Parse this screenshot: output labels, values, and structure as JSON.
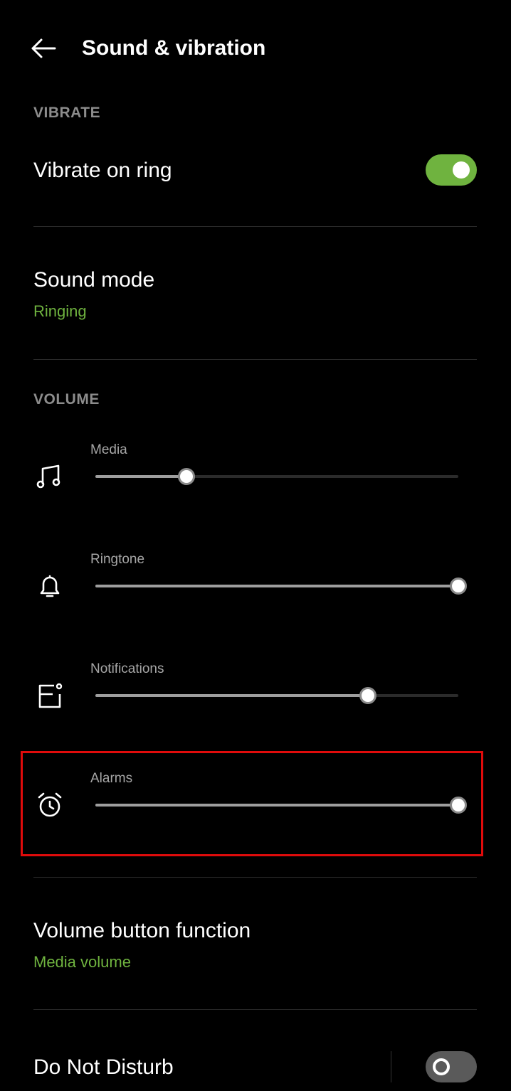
{
  "header": {
    "title": "Sound & vibration",
    "back_icon": "arrow-left-icon"
  },
  "vibrate_section": {
    "header": "VIBRATE",
    "vibrate_on_ring": {
      "label": "Vibrate on ring",
      "enabled": true
    }
  },
  "sound_mode": {
    "title": "Sound mode",
    "value": "Ringing"
  },
  "volume_section": {
    "header": "VOLUME",
    "sliders": [
      {
        "id": "media",
        "label": "Media",
        "icon": "music-note-icon",
        "level": 0.25
      },
      {
        "id": "ringtone",
        "label": "Ringtone",
        "icon": "bell-icon",
        "level": 1.0
      },
      {
        "id": "notifications",
        "label": "Notifications",
        "icon": "notification-icon",
        "level": 0.75
      },
      {
        "id": "alarms",
        "label": "Alarms",
        "icon": "alarm-clock-icon",
        "level": 1.0
      }
    ]
  },
  "volume_button_function": {
    "title": "Volume button function",
    "value": "Media volume"
  },
  "do_not_disturb": {
    "label": "Do Not Disturb",
    "enabled": false
  },
  "colors": {
    "accent": "#6fb33f",
    "toggle_on": "#6fb33f",
    "toggle_off": "#5a5a5a",
    "highlight": "#e00b0b",
    "section_header": "#8c8c8c"
  }
}
